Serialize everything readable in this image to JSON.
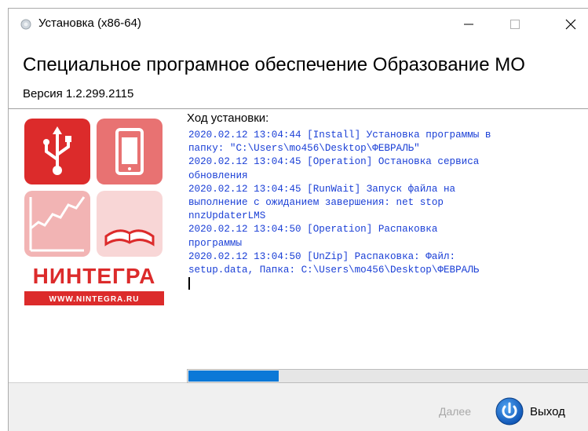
{
  "window": {
    "title": "Установка (x86-64)",
    "controls": {
      "minimize": "—",
      "maximize": "☐",
      "close": "✕"
    }
  },
  "header": {
    "product_name": "Специальное програмное обеспечение Образование МО",
    "version": "Версия 1.2.299.2115"
  },
  "logo": {
    "icons": [
      "usb-icon",
      "phone-icon",
      "chart-icon",
      "book-icon"
    ],
    "brand": "НИНТЕГРА",
    "url": "WWW.NINTEGRA.RU",
    "colors": {
      "red": "#dc2b2b",
      "mid_red": "#e87272",
      "light_red": "#f6c6c6",
      "pale_red": "#f8d6d6"
    }
  },
  "install": {
    "progress_label": "Ход установки:",
    "log_lines": [
      "2020.02.12 13:04:44 [Install] Установка программы в",
      "папку: \"C:\\Users\\mo456\\Desktop\\ФЕВРАЛЬ\"",
      "2020.02.12 13:04:45 [Operation] Остановка сервиса",
      "обновления",
      "2020.02.12 13:04:45 [RunWait] Запуск файла на",
      "выполнение с ожиданием завершения: net stop",
      "nnzUpdaterLMS",
      "2020.02.12 13:04:50 [Operation] Распаковка",
      "программы",
      "2020.02.12 13:04:50 [UnZip] Распаковка: Файл:",
      "setup.data, Папка: C:\\Users\\mo456\\Desktop\\ФЕВРАЛЬ"
    ],
    "log_color": "#1a3fd6",
    "progress_fraction": 0.23,
    "progress_color": "#0b78d7"
  },
  "footer": {
    "next_label": "Далее",
    "exit_label": "Выход",
    "exit_icon": "power-icon"
  }
}
